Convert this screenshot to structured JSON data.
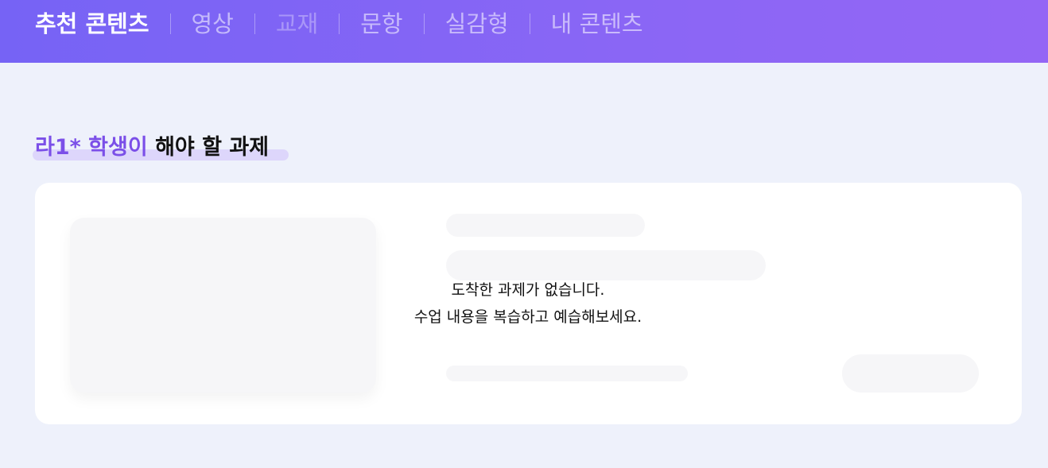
{
  "nav": {
    "tabs": [
      {
        "label": "추천 콘텐츠",
        "state": "active"
      },
      {
        "label": "영상",
        "state": "normal"
      },
      {
        "label": "교재",
        "state": "disabled"
      },
      {
        "label": "문항",
        "state": "normal"
      },
      {
        "label": "실감형",
        "state": "normal"
      },
      {
        "label": "내 콘텐츠",
        "state": "normal"
      }
    ]
  },
  "assignments": {
    "student_name": "라1* 학생이",
    "title_suffix": " 해야 할 과제",
    "empty_line1": "도착한 과제가 없습니다.",
    "empty_line2": "수업 내용을 복습하고 예습해보세요."
  },
  "colors": {
    "header_gradient_start": "#7663f5",
    "header_gradient_end": "#9466f5",
    "page_background": "#eef1fb",
    "accent_purple": "#7b4fe8",
    "highlight": "#ddd6fb",
    "skeleton": "#f6f6f8"
  }
}
